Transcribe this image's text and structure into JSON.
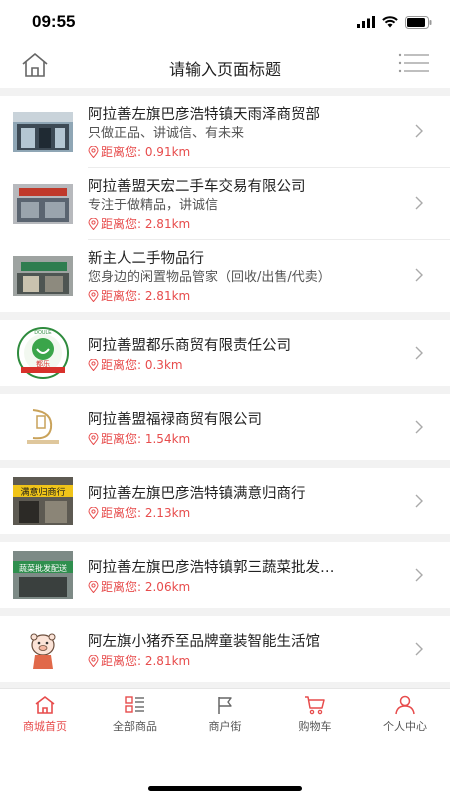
{
  "status": {
    "time": "09:55"
  },
  "header": {
    "title": "请输入页面标题"
  },
  "stores": [
    {
      "name": "阿拉善左旗巴彦浩特镇天雨泽商贸部",
      "desc": "只做正品、讲诚信、有未来",
      "distance": "距离您: 0.91km",
      "thumb": "storefront-photo"
    },
    {
      "name": "阿拉善盟天宏二手车交易有限公司",
      "desc": "专注于做精品，讲诚信",
      "distance": "距离您: 2.81km",
      "thumb": "storefront-photo"
    },
    {
      "name": "新主人二手物品行",
      "desc": "您身边的闲置物品管家（回收/出售/代卖）",
      "distance": "距离您: 2.81km",
      "thumb": "storefront-photo"
    },
    {
      "name": "阿拉善盟都乐商贸有限责任公司",
      "desc": "",
      "distance": "距离您: 0.3km",
      "thumb": "dule-logo",
      "logo_text": "都乐",
      "logo_ring": "DOULE"
    },
    {
      "name": "阿拉善盟福禄商贸有限公司",
      "desc": "",
      "distance": "距离您: 1.54km",
      "thumb": "fulu-logo"
    },
    {
      "name": "阿拉善左旗巴彦浩特镇满意归商行",
      "desc": "",
      "distance": "距离您: 2.13km",
      "thumb": "storefront-photo",
      "sign_text": "满意归商行"
    },
    {
      "name": "阿拉善左旗巴彦浩特镇郭三蔬菜批发…",
      "desc": "",
      "distance": "距离您: 2.06km",
      "thumb": "storefront-photo",
      "sign_text": "蔬菜批发配送"
    },
    {
      "name": "阿左旗小猪乔至品牌童装智能生活馆",
      "desc": "",
      "distance": "距离您: 2.81km",
      "thumb": "pig-logo"
    }
  ],
  "tabs": [
    {
      "label": "商城首页",
      "icon": "home-icon",
      "active": true
    },
    {
      "label": "全部商品",
      "icon": "grid-list-icon",
      "active": false
    },
    {
      "label": "商户街",
      "icon": "flag-icon",
      "active": false
    },
    {
      "label": "购物车",
      "icon": "cart-icon",
      "active": false
    },
    {
      "label": "个人中心",
      "icon": "person-icon",
      "active": false
    }
  ],
  "colors": {
    "accent": "#e74c4c",
    "divider": "#ececec",
    "background": "#f2f2f2"
  }
}
